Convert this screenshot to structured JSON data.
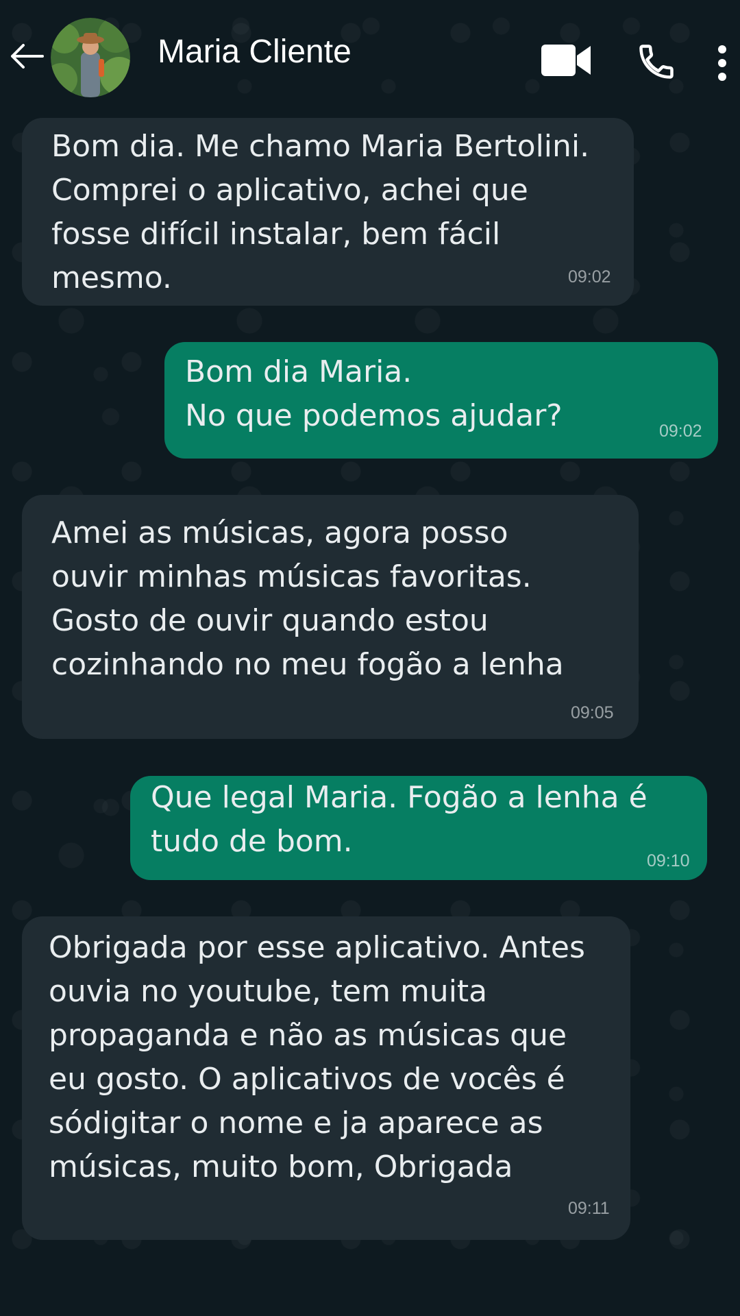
{
  "header": {
    "contact_name": "Maria Cliente",
    "icons": {
      "back": "back-arrow-icon",
      "video": "video-camera-icon",
      "call": "phone-icon",
      "menu": "more-vertical-icon"
    }
  },
  "colors": {
    "incoming_bubble": "#202c33",
    "outgoing_bubble": "#067e62",
    "background": "#0b141a",
    "text": "#e9edef"
  },
  "messages": [
    {
      "direction": "incoming",
      "text": "Bom dia. Me chamo Maria Bertolini.\nComprei o aplicativo, achei que\nfosse difícil instalar, bem fácil\nmesmo.",
      "time": "09:02"
    },
    {
      "direction": "outgoing",
      "text": "Bom dia Maria.\nNo que podemos ajudar?",
      "time": "09:02"
    },
    {
      "direction": "incoming",
      "text": "Amei as músicas, agora posso\nouvir minhas músicas favoritas.\nGosto de ouvir quando estou\ncozinhando no meu fogão a lenha",
      "time": "09:05"
    },
    {
      "direction": "outgoing",
      "text": "Que legal Maria. Fogão a lenha é\ntudo de bom.",
      "time": "09:10"
    },
    {
      "direction": "incoming",
      "text": "Obrigada por esse aplicativo. Antes\nouvia no youtube, tem muita\npropaganda e não as músicas que\neu gosto. O aplicativos de vocês é\nsódigitar o nome e ja aparece as\nmúsicas, muito bom, Obrigada",
      "time": "09:11"
    }
  ]
}
